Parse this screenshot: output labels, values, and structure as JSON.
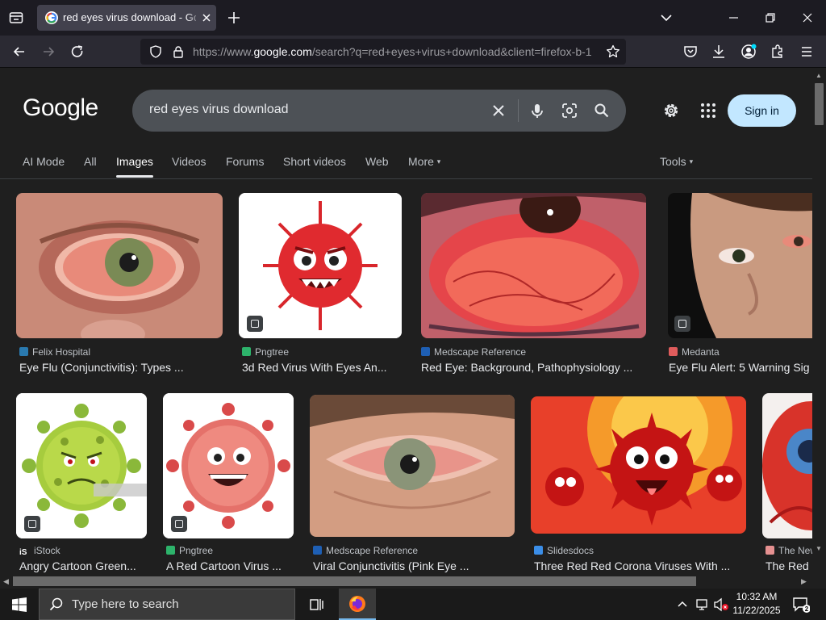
{
  "browser": {
    "tab_title": "red eyes virus download - Goog",
    "url_prefix": "https://www.",
    "url_domain": "google.com",
    "url_rest": "/search?q=red+eyes+virus+download&client=firefox-b-1"
  },
  "google": {
    "logo": "Google",
    "query": "red eyes virus download",
    "sign_in": "Sign in",
    "tabs": [
      {
        "label": "AI Mode"
      },
      {
        "label": "All"
      },
      {
        "label": "Images",
        "active": true
      },
      {
        "label": "Videos"
      },
      {
        "label": "Forums"
      },
      {
        "label": "Short videos"
      },
      {
        "label": "Web"
      },
      {
        "label": "More"
      }
    ],
    "tools": "Tools"
  },
  "results": [
    {
      "source": "Felix Hospital",
      "caption": "Eye Flu (Conjunctivitis): Types ...",
      "color": "#2a7ab0"
    },
    {
      "source": "Pngtree",
      "caption": "3d Red Virus With Eyes An...",
      "color": "#2db36b"
    },
    {
      "source": "Medscape Reference",
      "caption": "Red Eye: Background, Pathophysiology ...",
      "color": "#1e5fb4"
    },
    {
      "source": "Medanta",
      "caption": "Eye Flu Alert: 5 Warning Sig",
      "color": "#e05c5c"
    },
    {
      "source": "iStock",
      "caption": "Angry Cartoon Green...",
      "color": "#ffffff"
    },
    {
      "source": "Pngtree",
      "caption": "A Red Cartoon Virus ...",
      "color": "#2db36b"
    },
    {
      "source": "Medscape Reference",
      "caption": "Viral Conjunctivitis (Pink Eye ...",
      "color": "#1e5fb4"
    },
    {
      "source": "Slidesdocs",
      "caption": "Three Red Red Corona Viruses With ...",
      "color": "#3b8ee8"
    },
    {
      "source": "The New",
      "caption": "The Red",
      "color": "#e59090"
    }
  ],
  "taskbar": {
    "search_placeholder": "Type here to search",
    "time": "10:32 AM",
    "date": "11/22/2025"
  }
}
